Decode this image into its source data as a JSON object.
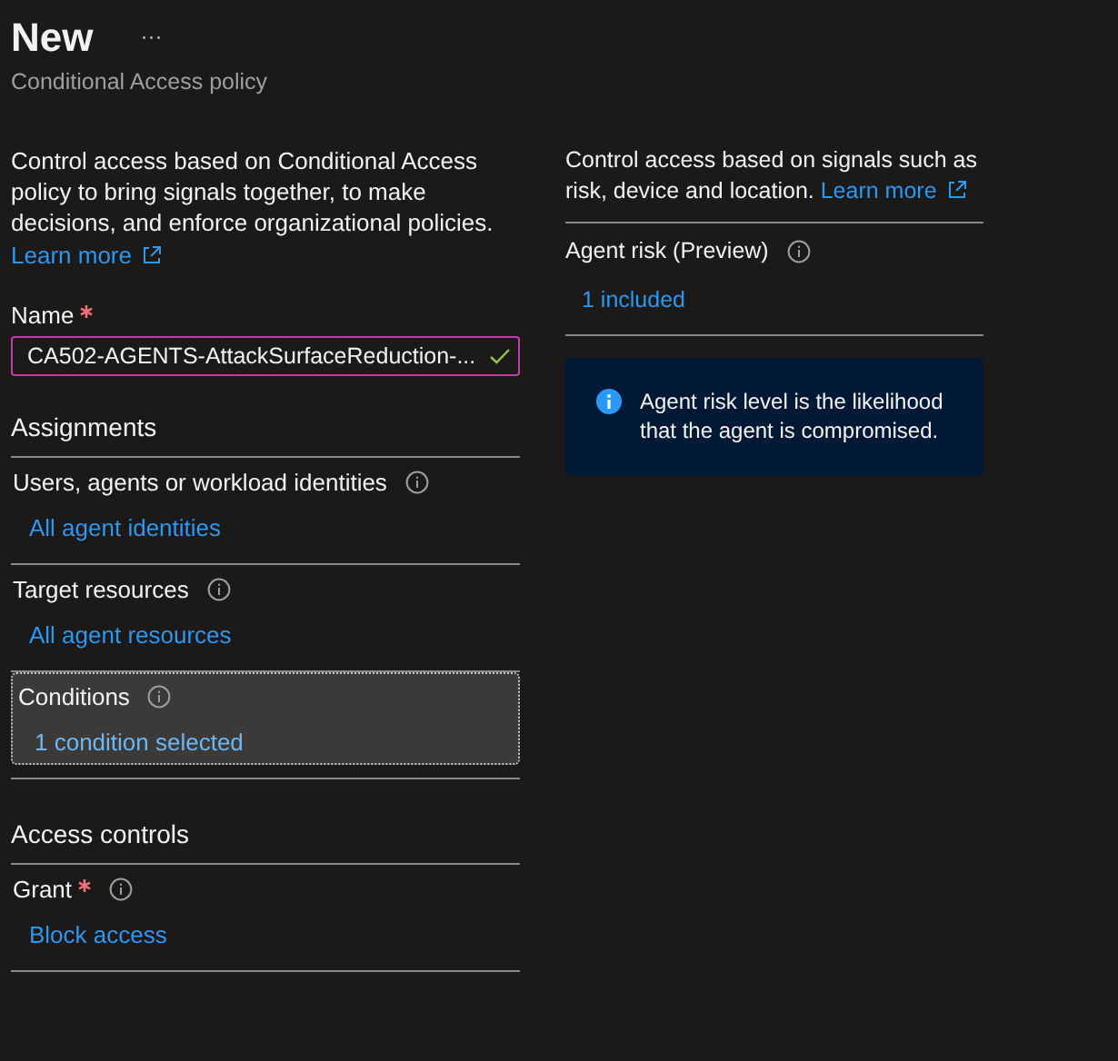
{
  "header": {
    "title": "New",
    "more": "···",
    "subtitle": "Conditional Access policy"
  },
  "left": {
    "description": "Control access based on Conditional Access policy to bring signals together, to make decisions, and enforce organizational policies.",
    "learn_more": "Learn more",
    "name_field": {
      "label": "Name",
      "required": true,
      "value": "CA502-AGENTS-AttackSurfaceReduction-...",
      "valid": true
    },
    "sections": [
      {
        "heading": "Assignments",
        "items": [
          {
            "label": "Users, agents or workload identities",
            "required": false,
            "value": "All agent identities",
            "selected": false
          },
          {
            "label": "Target resources",
            "required": false,
            "value": "All agent resources",
            "selected": false
          },
          {
            "label": "Conditions",
            "required": false,
            "value": "1 condition selected",
            "selected": true
          }
        ]
      },
      {
        "heading": "Access controls",
        "items": [
          {
            "label": "Grant",
            "required": true,
            "value": "Block access",
            "selected": false
          }
        ]
      }
    ]
  },
  "right": {
    "description": "Control access based on signals such as risk, device and location.",
    "learn_more": "Learn more",
    "item": {
      "label": "Agent risk (Preview)",
      "value": "1 included"
    },
    "info_box": "Agent risk level is the likelihood that the agent is compromised."
  }
}
